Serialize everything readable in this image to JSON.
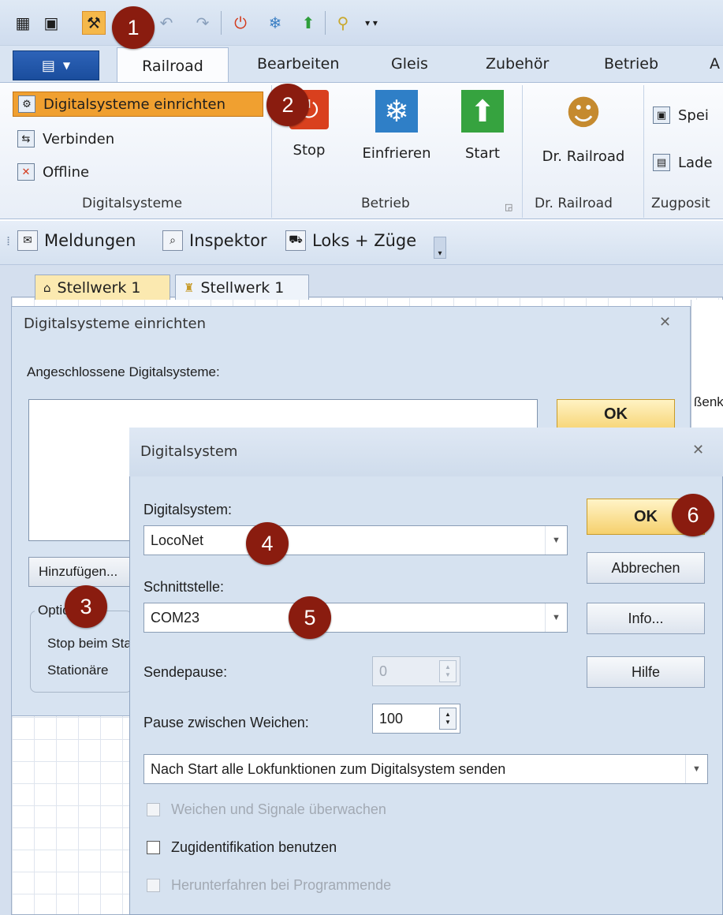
{
  "quick_access": {
    "icons": [
      "app-icon",
      "save-icon",
      "tools-icon",
      "undo-icon",
      "redo-icon",
      "stop-icon",
      "freeze-icon",
      "start-icon",
      "pin-icon",
      "dropdown-icon"
    ]
  },
  "ribbon": {
    "tabs": [
      "Railroad",
      "Bearbeiten",
      "Gleis",
      "Zubehör",
      "Betrieb",
      "A"
    ],
    "digital": {
      "setup": "Digitalsysteme einrichten",
      "connect": "Verbinden",
      "offline": "Offline",
      "group": "Digitalsysteme"
    },
    "betrieb": {
      "stop": "Stop",
      "freeze": "Einfrieren",
      "start": "Start",
      "group": "Betrieb"
    },
    "dr": {
      "button": "Dr. Railroad",
      "group": "Dr. Railroad"
    },
    "zug": {
      "save": "Spei",
      "load": "Lade",
      "group": "Zugposit"
    }
  },
  "toolbar2": {
    "messages": "Meldungen",
    "inspector": "Inspektor",
    "locos": "Loks + Züge"
  },
  "doc_tabs": [
    "Stellwerk 1",
    "Stellwerk 1"
  ],
  "dialog1": {
    "title": "Digitalsysteme einrichten",
    "connected_label": "Angeschlossene Digitalsysteme:",
    "ok": "OK",
    "add": "Hinzufügen...",
    "options_label": "Optionen:",
    "stop_line": "Stop beim Start",
    "station_line": "Stationäre",
    "side_text": "ßenk"
  },
  "dialog2": {
    "title": "Digitalsystem",
    "system_label": "Digitalsystem:",
    "system_value": "LocoNet",
    "interface_label": "Schnittstelle:",
    "interface_value": "COM23",
    "send_pause_label": "Sendepause:",
    "send_pause_value": "0",
    "switch_pause_label": "Pause zwischen Weichen:",
    "switch_pause_value": "100",
    "start_option": "Nach Start alle Lokfunktionen zum Digitalsystem senden",
    "chk_monitor": "Weichen und Signale überwachen",
    "chk_train_id": "Zugidentifikation benutzen",
    "chk_shutdown": "Herunterfahren bei Programmende",
    "ok": "OK",
    "cancel": "Abbrechen",
    "info": "Info...",
    "help": "Hilfe"
  },
  "callouts": [
    "1",
    "2",
    "3",
    "4",
    "5",
    "6"
  ],
  "colors": {
    "callout": "#8a1c0f",
    "ok_button": "#f6d06c",
    "active_ribbon_item": "#f0a030",
    "app_menu": "#1f57aa"
  }
}
